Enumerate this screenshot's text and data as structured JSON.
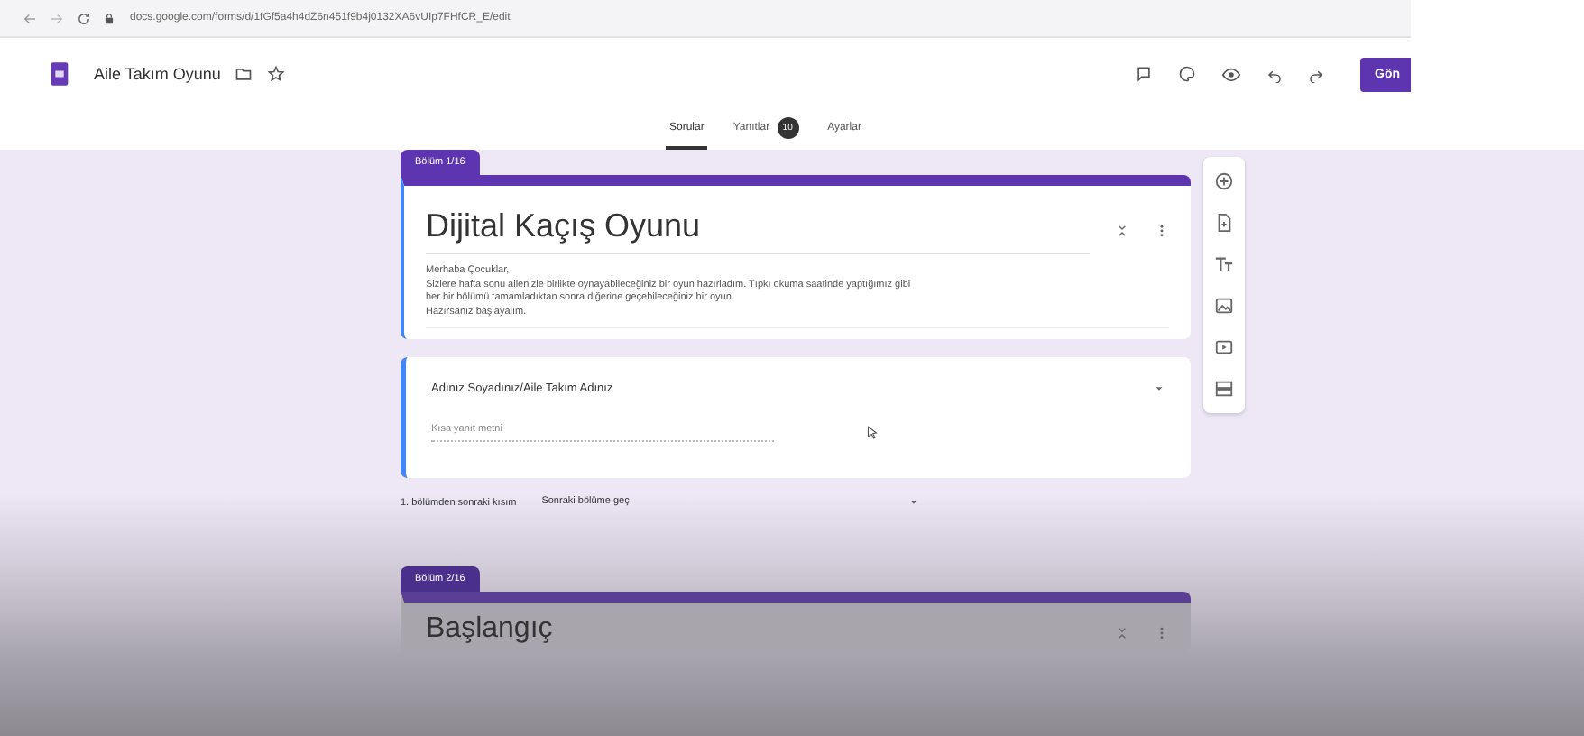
{
  "browser": {
    "url": "docs.google.com/forms/d/1fGf5a4h4dZ6n451f9b4j0132XA6vUIp7FHfCR_E/edit"
  },
  "header": {
    "title": "Aile Takım Oyunu",
    "send_button": "Gön"
  },
  "tabs": [
    {
      "label": "Sorular",
      "selected": true
    },
    {
      "label": "Yanıtlar",
      "selected": false,
      "badge": "10"
    },
    {
      "label": "Ayarlar",
      "selected": false
    }
  ],
  "sections": [
    {
      "tag": "Bölüm 1/16",
      "title": "Dijital Kaçış Oyunu",
      "description": [
        "Merhaba Çocuklar,",
        "Sizlere hafta sonu ailenizle birlikte oynayabileceğiniz bir oyun hazırladım. Tıpkı okuma saatinde yaptığımız gibi",
        "her bir bölümü tamamladıktan sonra diğerine geçebileceğiniz bir oyun.",
        "Hazırsanız başlayalım."
      ],
      "questions": [
        {
          "title": "Adınız Soyadınız/Aile Takım Adınız",
          "placeholder": "Kısa yanıt metni"
        }
      ],
      "after": {
        "label": "1. bölümden sonraki kısım",
        "value": "Sonraki bölüme geç"
      }
    },
    {
      "tag": "Bölüm 2/16",
      "title": "Başlangıç"
    }
  ]
}
